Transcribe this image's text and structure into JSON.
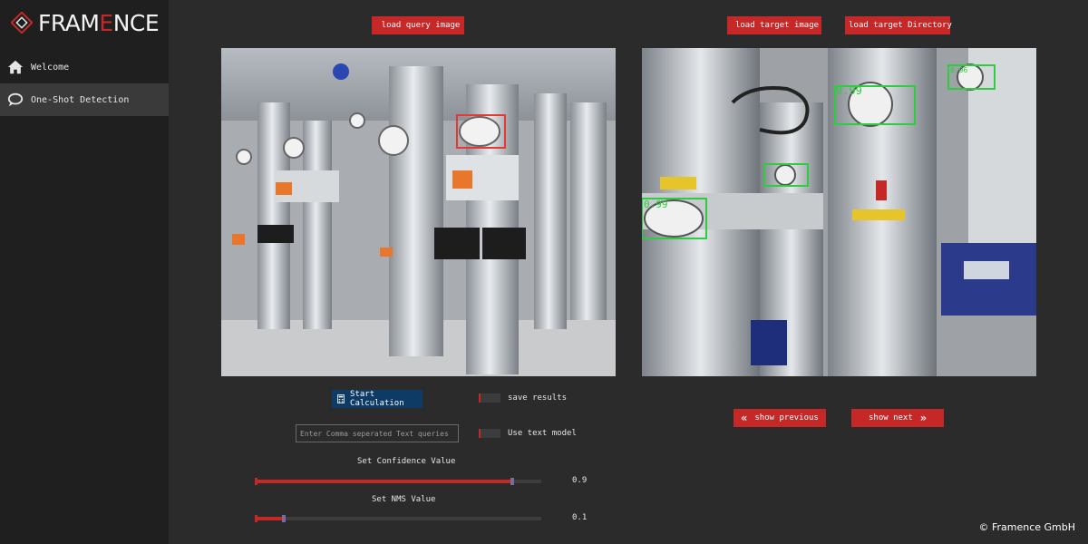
{
  "brand": {
    "logo_text_prefix": "FRAM",
    "logo_text_accent": "E",
    "logo_text_suffix": "NCE",
    "accent_color": "#c62828"
  },
  "sidebar": {
    "items": [
      {
        "label": "Welcome",
        "icon": "home-icon",
        "active": false
      },
      {
        "label": "One-Shot Detection",
        "icon": "chat-bubble-icon",
        "active": true
      }
    ]
  },
  "toolbar": {
    "load_query_label": "load query image",
    "load_target_label": "load target image",
    "load_target_dir_label": "load target Directory"
  },
  "query_panel": {
    "detections": [
      {
        "label": "",
        "color": "#e53935"
      }
    ]
  },
  "target_panel": {
    "detections": [
      {
        "label": "0.99",
        "color": "#2ecc40"
      },
      {
        "label": "0.96",
        "color": "#2ecc40"
      },
      {
        "label": "0.99",
        "color": "#2ecc40"
      },
      {
        "label": "",
        "color": "#2ecc40"
      }
    ]
  },
  "controls": {
    "start_label": "Start Calculation",
    "save_results_label": "save results",
    "text_query_placeholder": "Enter Comma seperated Text queries",
    "use_text_model_label": "Use text model",
    "confidence_label": "Set Confidence Value",
    "confidence_value": "0.9",
    "confidence_fraction": 0.9,
    "nms_label": "Set NMS Value",
    "nms_value": "0.1",
    "nms_fraction": 0.1
  },
  "navigation": {
    "previous_label": "show previous",
    "next_label": "show next"
  },
  "footer": {
    "copyright": "© Framence GmbH"
  }
}
